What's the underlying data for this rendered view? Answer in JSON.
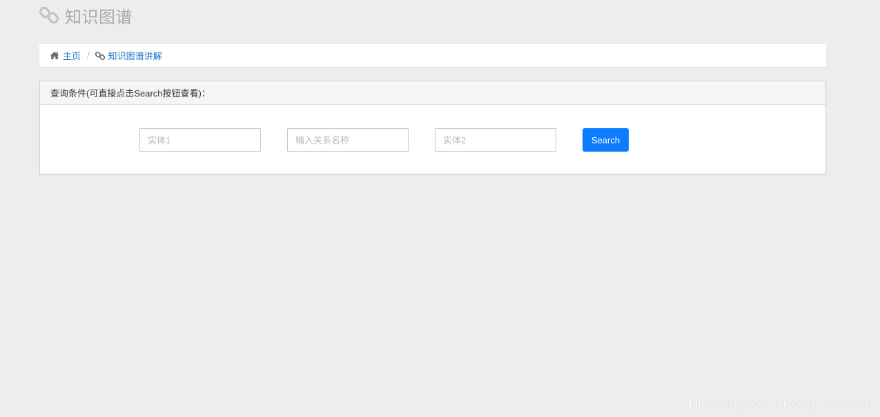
{
  "header": {
    "icon": "link-icon",
    "title": "知识图谱"
  },
  "breadcrumb": {
    "items": [
      {
        "icon": "home-icon",
        "label": "主页"
      },
      {
        "icon": "link-icon",
        "label": "知识图谱讲解"
      }
    ],
    "separator": "/"
  },
  "query_panel": {
    "heading": "查询条件(可直接点击Search按钮查看)：",
    "entity1_placeholder": "实体1",
    "relation_placeholder": "输入关系名称",
    "entity2_placeholder": "实体2",
    "entity1_value": "",
    "relation_value": "",
    "entity2_value": "",
    "search_label": "Search"
  },
  "watermark": "https://blog.csdn.net/weixin_43788143",
  "colors": {
    "background": "#ededed",
    "link": "#1a73c7",
    "primary_button": "#0d7dff",
    "header_title": "#a8a8a8"
  }
}
